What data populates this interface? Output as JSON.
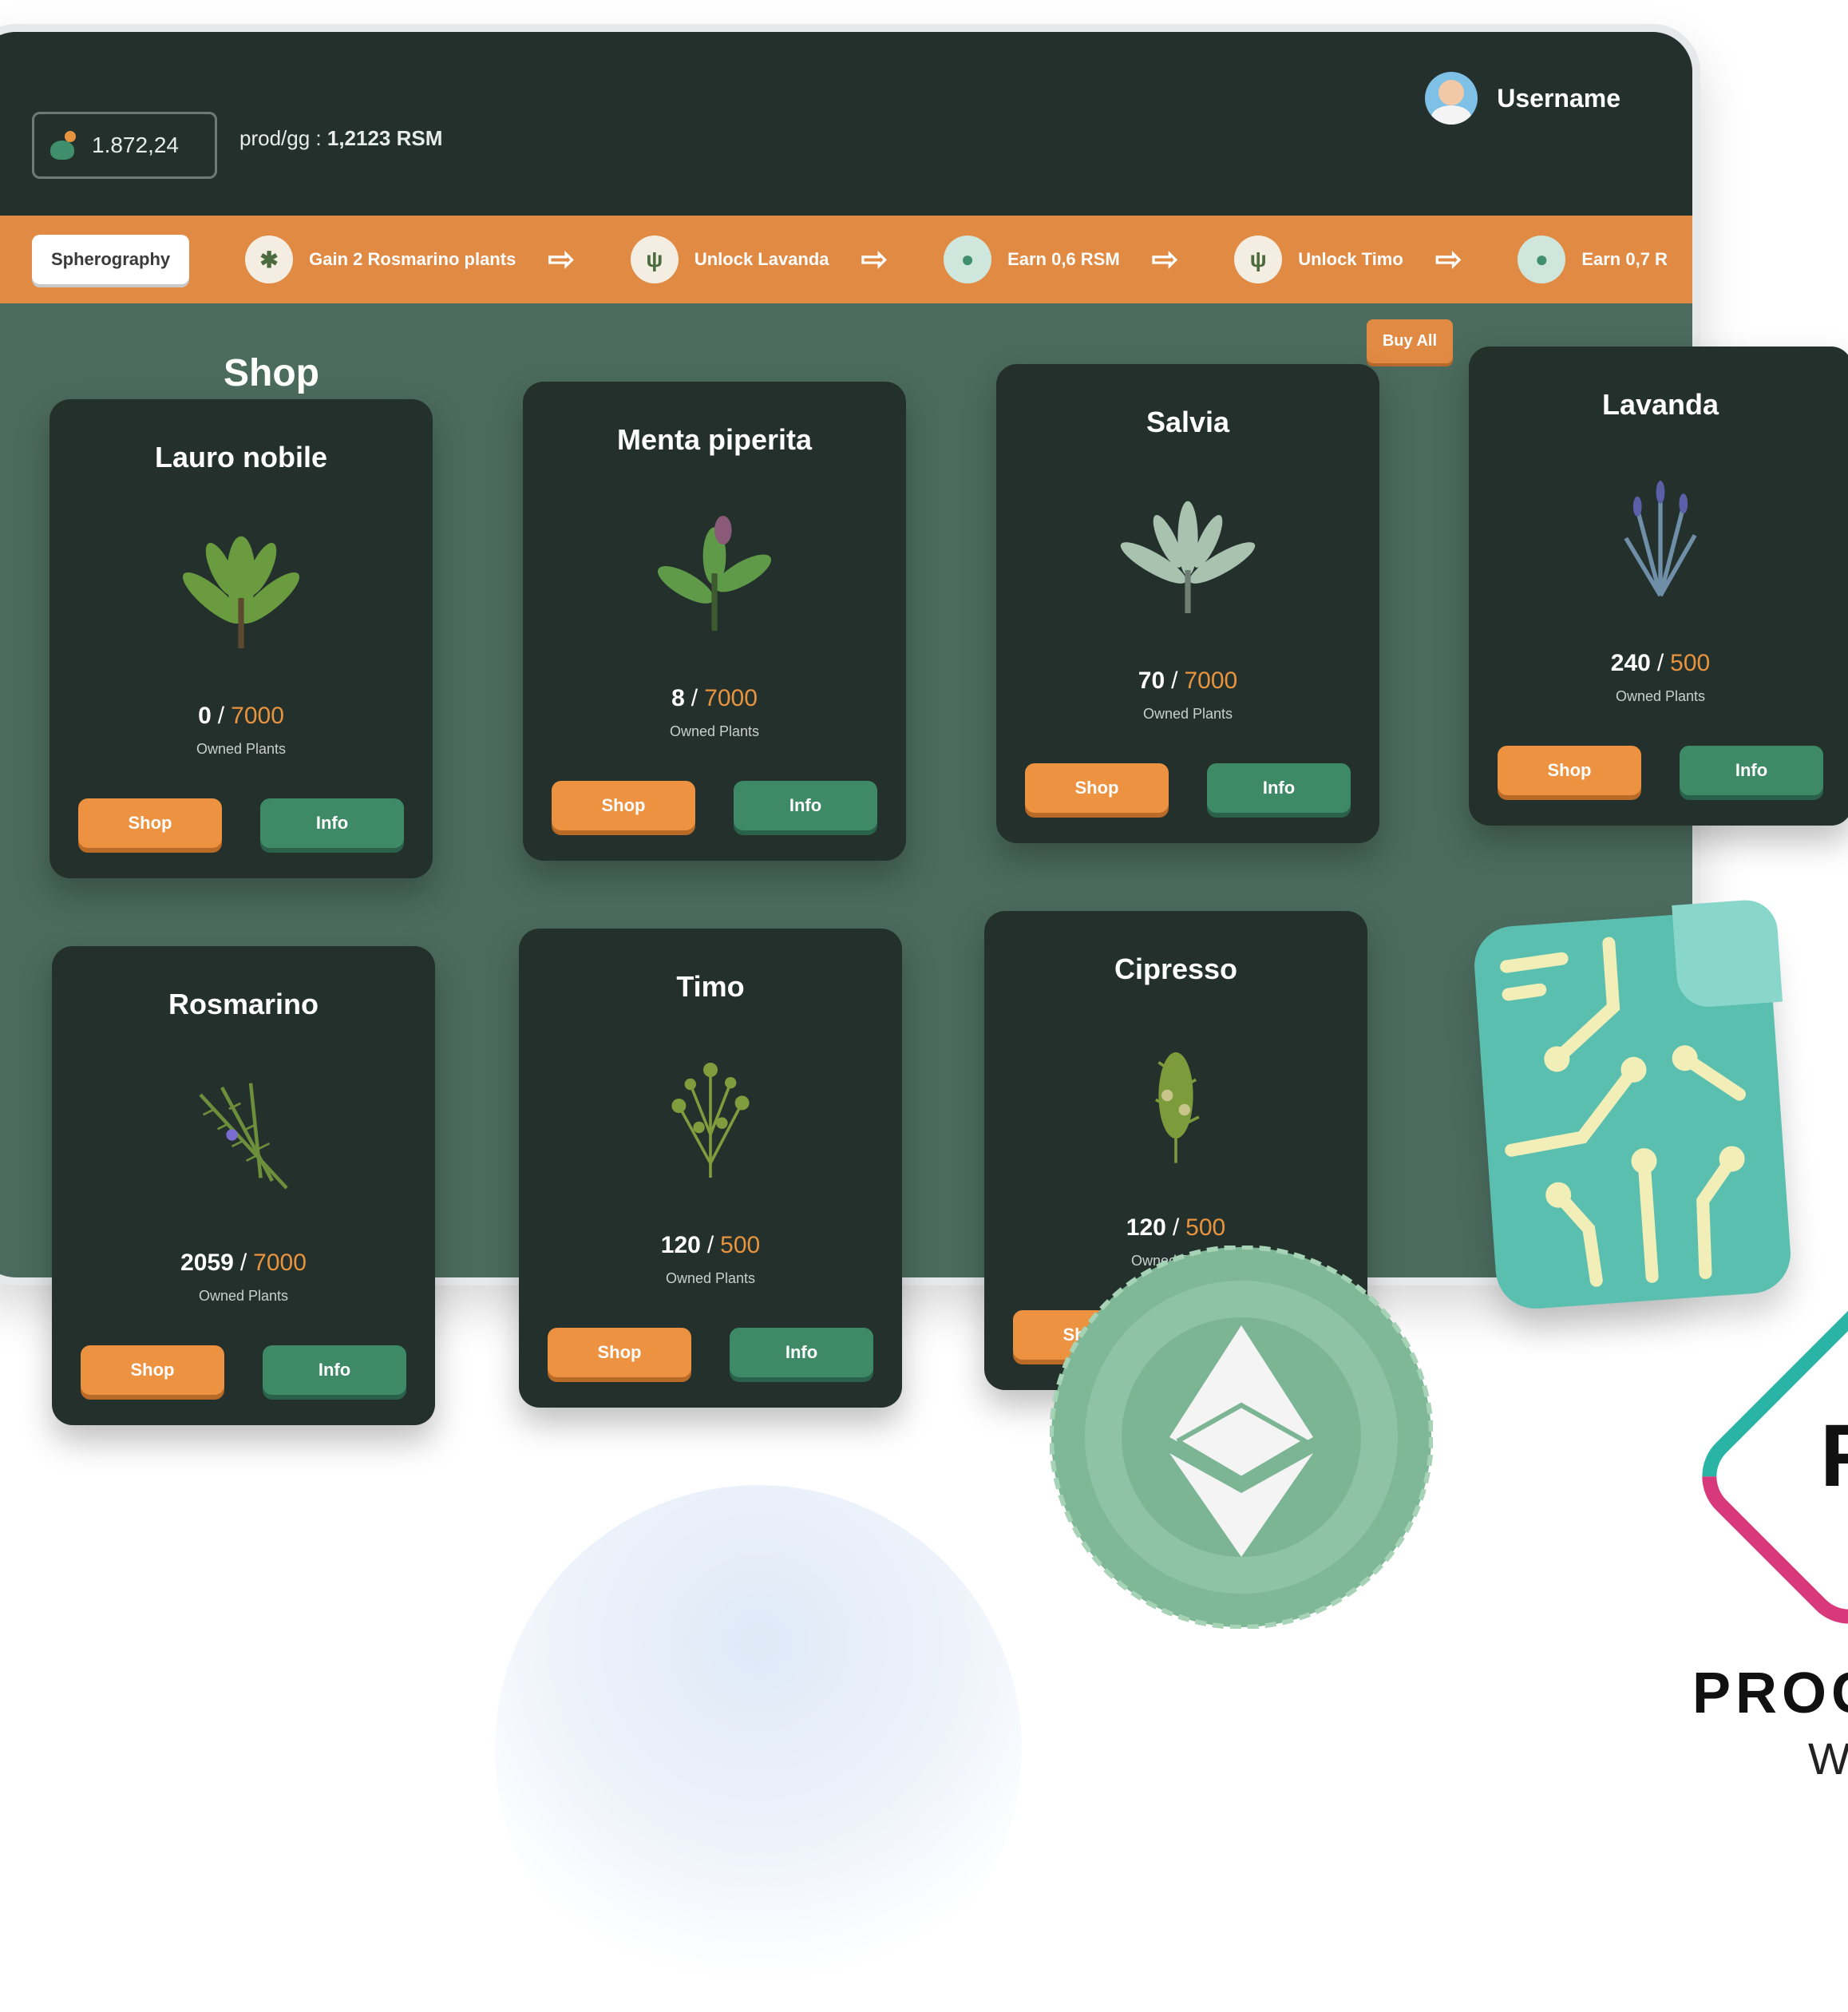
{
  "header": {
    "balance": "1.872,24",
    "prod_label": "prod/gg : ",
    "prod_value": "1,2123 RSM",
    "username": "Username"
  },
  "quest": {
    "tag": "Spherography",
    "steps": [
      {
        "label": "Gain 2 Rosmarino plants",
        "icon": "rosmarino-icon"
      },
      {
        "label": "Unlock Lavanda",
        "icon": "lavanda-icon"
      },
      {
        "label": "Earn 0,6 RSM",
        "icon": "potion-icon"
      },
      {
        "label": "Unlock Timo",
        "icon": "timo-icon"
      },
      {
        "label": "Earn 0,7 R",
        "icon": "potion-icon"
      }
    ]
  },
  "shop": {
    "title": "Shop",
    "buy_all": "Buy All",
    "owned_label": "Owned Plants",
    "shop_label": "Shop",
    "info_label": "Info",
    "cards": [
      {
        "name": "Lauro nobile",
        "owned": "0",
        "max": "7000",
        "leaf": "#6b9b3f"
      },
      {
        "name": "Menta piperita",
        "owned": "8",
        "max": "7000",
        "leaf": "#5f9a48"
      },
      {
        "name": "Salvia",
        "owned": "70",
        "max": "7000",
        "leaf": "#a9c2b0"
      },
      {
        "name": "Lavanda",
        "owned": "240",
        "max": "500",
        "leaf": "#6f8fa8"
      },
      {
        "name": "Rosmarino",
        "owned": "2059",
        "max": "7000",
        "leaf": "#6d8f3c"
      },
      {
        "name": "Timo",
        "owned": "120",
        "max": "500",
        "leaf": "#7f9d3d"
      },
      {
        "name": "Cipresso",
        "owned": "120",
        "max": "500",
        "leaf": "#7c9b3b"
      }
    ]
  },
  "brand": {
    "text": "PROC",
    "sub": "W",
    "letter": "F"
  },
  "colors": {
    "accent": "#e18a43",
    "card_bg": "#23302c",
    "panel_bg": "#4b6b5e",
    "info_green": "#3e8a67"
  }
}
